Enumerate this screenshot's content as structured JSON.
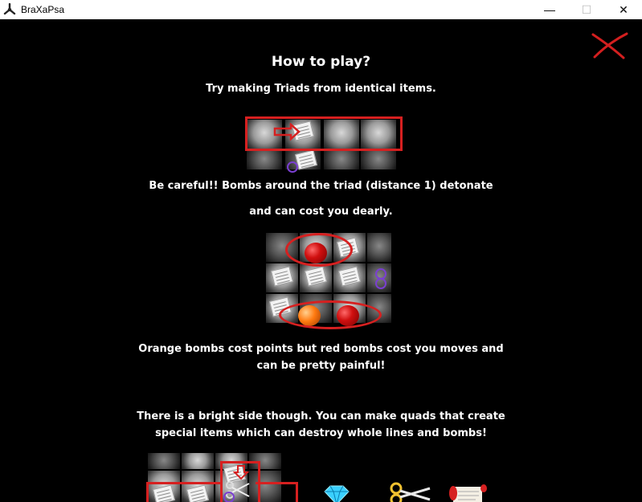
{
  "window": {
    "title": "BraXaPsa",
    "minimize_glyph": "—",
    "maximize_glyph": "☐",
    "close_glyph": "✕"
  },
  "help": {
    "heading": "How to play?",
    "line1": "Try making Triads from identical items.",
    "line2a": "Be careful!!  Bombs around the triad (distance 1) detonate",
    "line2b": "and can cost you dearly.",
    "line3a": "Orange bombs cost points but red bombs cost you moves and",
    "line3b": "can be pretty painful!",
    "line4a": "There is a bright side though. You can make quads that create",
    "line4b": "special items which can destroy whole lines and bombs!"
  },
  "icons": {
    "app": "braxapsa-app-icon",
    "close": "red-x-close-icon",
    "special_items": [
      "diamond-icon",
      "scissors-icon",
      "scroll-icon"
    ]
  },
  "colors": {
    "background": "#000000",
    "text": "#ffffff",
    "highlight": "#d62020",
    "bomb_red": "#d01010",
    "bomb_orange": "#ff7a10",
    "diamond": "#3ad0ff"
  }
}
